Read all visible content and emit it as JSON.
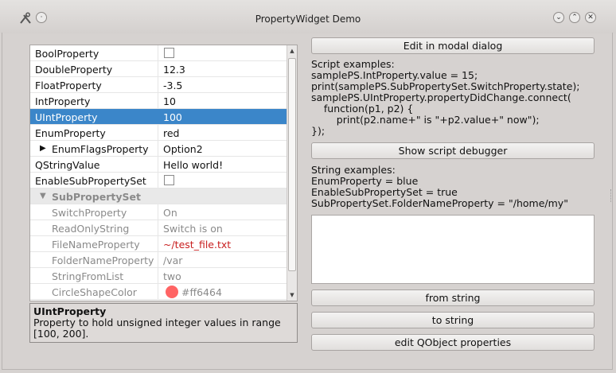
{
  "window": {
    "title": "PropertyWidget Demo"
  },
  "tree": {
    "rows": [
      {
        "name": "BoolProperty",
        "value": ""
      },
      {
        "name": "DoubleProperty",
        "value": "12.3"
      },
      {
        "name": "FloatProperty",
        "value": "-3.5"
      },
      {
        "name": "IntProperty",
        "value": "10"
      },
      {
        "name": "UIntProperty",
        "value": "100"
      },
      {
        "name": "EnumProperty",
        "value": "red"
      },
      {
        "name": "EnumFlagsProperty",
        "value": "Option2"
      },
      {
        "name": "QStringValue",
        "value": "Hello world!"
      },
      {
        "name": "EnableSubPropertySet",
        "value": ""
      },
      {
        "name": "SubPropertySet",
        "value": ""
      },
      {
        "name": "SwitchProperty",
        "value": "On"
      },
      {
        "name": "ReadOnlyString",
        "value": "Switch is on"
      },
      {
        "name": "FileNameProperty",
        "value": "~/test_file.txt"
      },
      {
        "name": "FolderNameProperty",
        "value": "/var"
      },
      {
        "name": "StringFromList",
        "value": "two"
      },
      {
        "name": "CircleShapeColor",
        "value": "#ff6464"
      }
    ],
    "selected_row": "UIntProperty",
    "expand_collapsed_glyph": "▶",
    "expand_open_glyph": "▼"
  },
  "description": {
    "title": "UIntProperty",
    "text": "Property to hold unsigned integer values in range [100, 200]."
  },
  "right": {
    "edit_modal_label": "Edit in modal dialog",
    "script_examples": "Script examples:\nsamplePS.IntProperty.value = 15;\nprint(samplePS.SubPropertySet.SwitchProperty.state);\nsamplePS.UIntProperty.propertyDidChange.connect(\n    function(p1, p2) {\n        print(p2.name+\" is \"+p2.value+\" now\");\n});",
    "show_debugger_label": "Show script debugger",
    "string_examples": "String examples:\nEnumProperty = blue\nEnableSubPropertySet = true\nSubPropertySet.FolderNameProperty = \"/home/my\"",
    "from_string_label": "from string",
    "to_string_label": "to string",
    "edit_qobject_label": "edit QObject properties"
  },
  "colors": {
    "selection": "#3b86c9",
    "circle_shape": "#ff6464",
    "filename_text": "#c81e1e"
  }
}
